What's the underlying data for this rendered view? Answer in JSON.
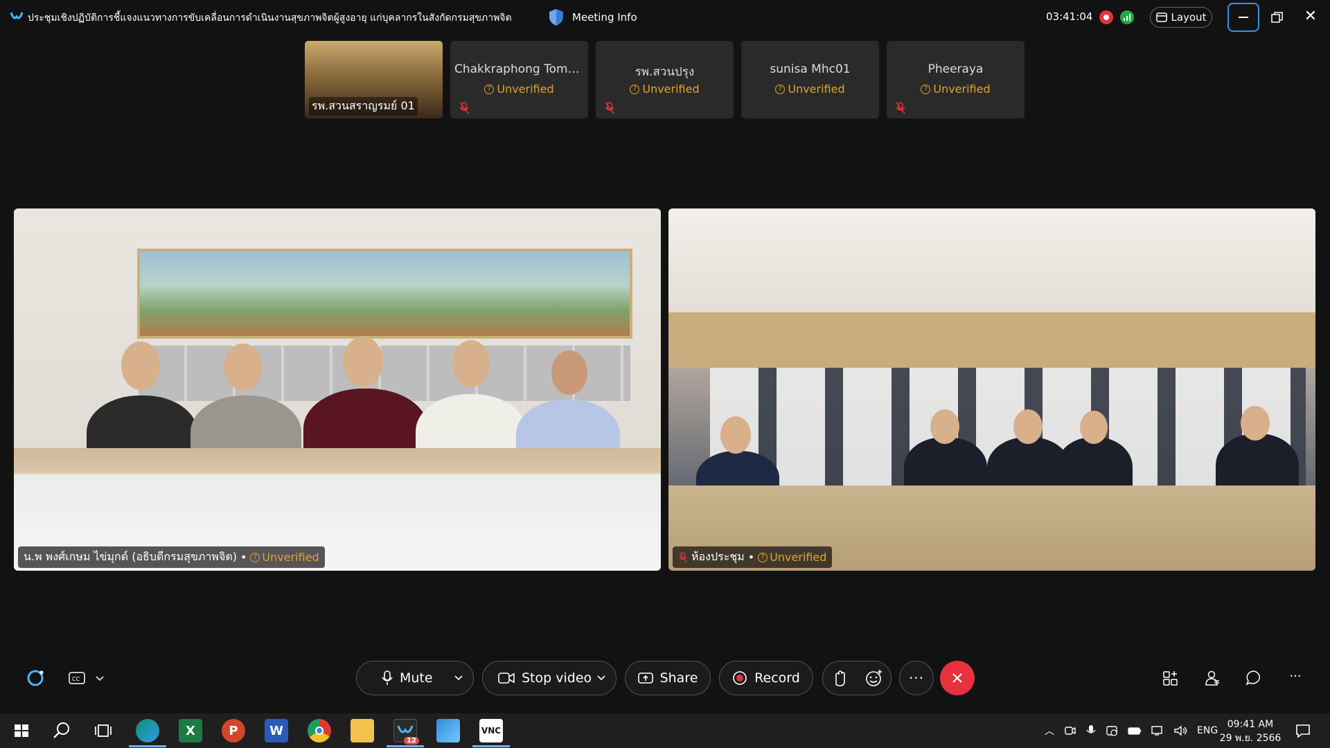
{
  "titlebar": {
    "meeting_title": "ประชุมเชิงปฏิบัติการชี้แจงแนวทางการขับเคลื่อนการดำเนินงานสุขภาพจิตผู้สูงอายุ แก่บุคลากรในสังกัดกรมสุขภาพจิต",
    "meeting_info_label": "Meeting Info",
    "elapsed_time": "03:41:04",
    "layout_label": "Layout"
  },
  "thumbnails": [
    {
      "name": "รพ.สวนสราญรมย์ 01",
      "type": "video"
    },
    {
      "name": "Chakkraphong Tomo...",
      "status": "Unverified",
      "muted": true
    },
    {
      "name": "รพ.สวนปรุง",
      "status": "Unverified",
      "muted": true
    },
    {
      "name": "sunisa Mhc01",
      "status": "Unverified",
      "muted": false
    },
    {
      "name": "Pheeraya",
      "status": "Unverified",
      "muted": true
    }
  ],
  "tiles": {
    "left": {
      "name": "น.พ พงศ์เกษม ไข่มุกด์ (อธิบดีกรมสุขภาพจิต)",
      "status": "Unverified"
    },
    "right": {
      "name": "ห้องประชุม",
      "status": "Unverified"
    }
  },
  "controls": {
    "mute_label": "Mute",
    "stop_video_label": "Stop video",
    "share_label": "Share",
    "record_label": "Record"
  },
  "taskbar": {
    "language": "ENG",
    "time": "09:41 AM",
    "date": "29 พ.ย. 2566",
    "webex_badge": "12"
  },
  "colors": {
    "unverified": "#e0a52a",
    "record": "#e5323c",
    "network": "#20a845",
    "end_call": "#e5323c"
  }
}
